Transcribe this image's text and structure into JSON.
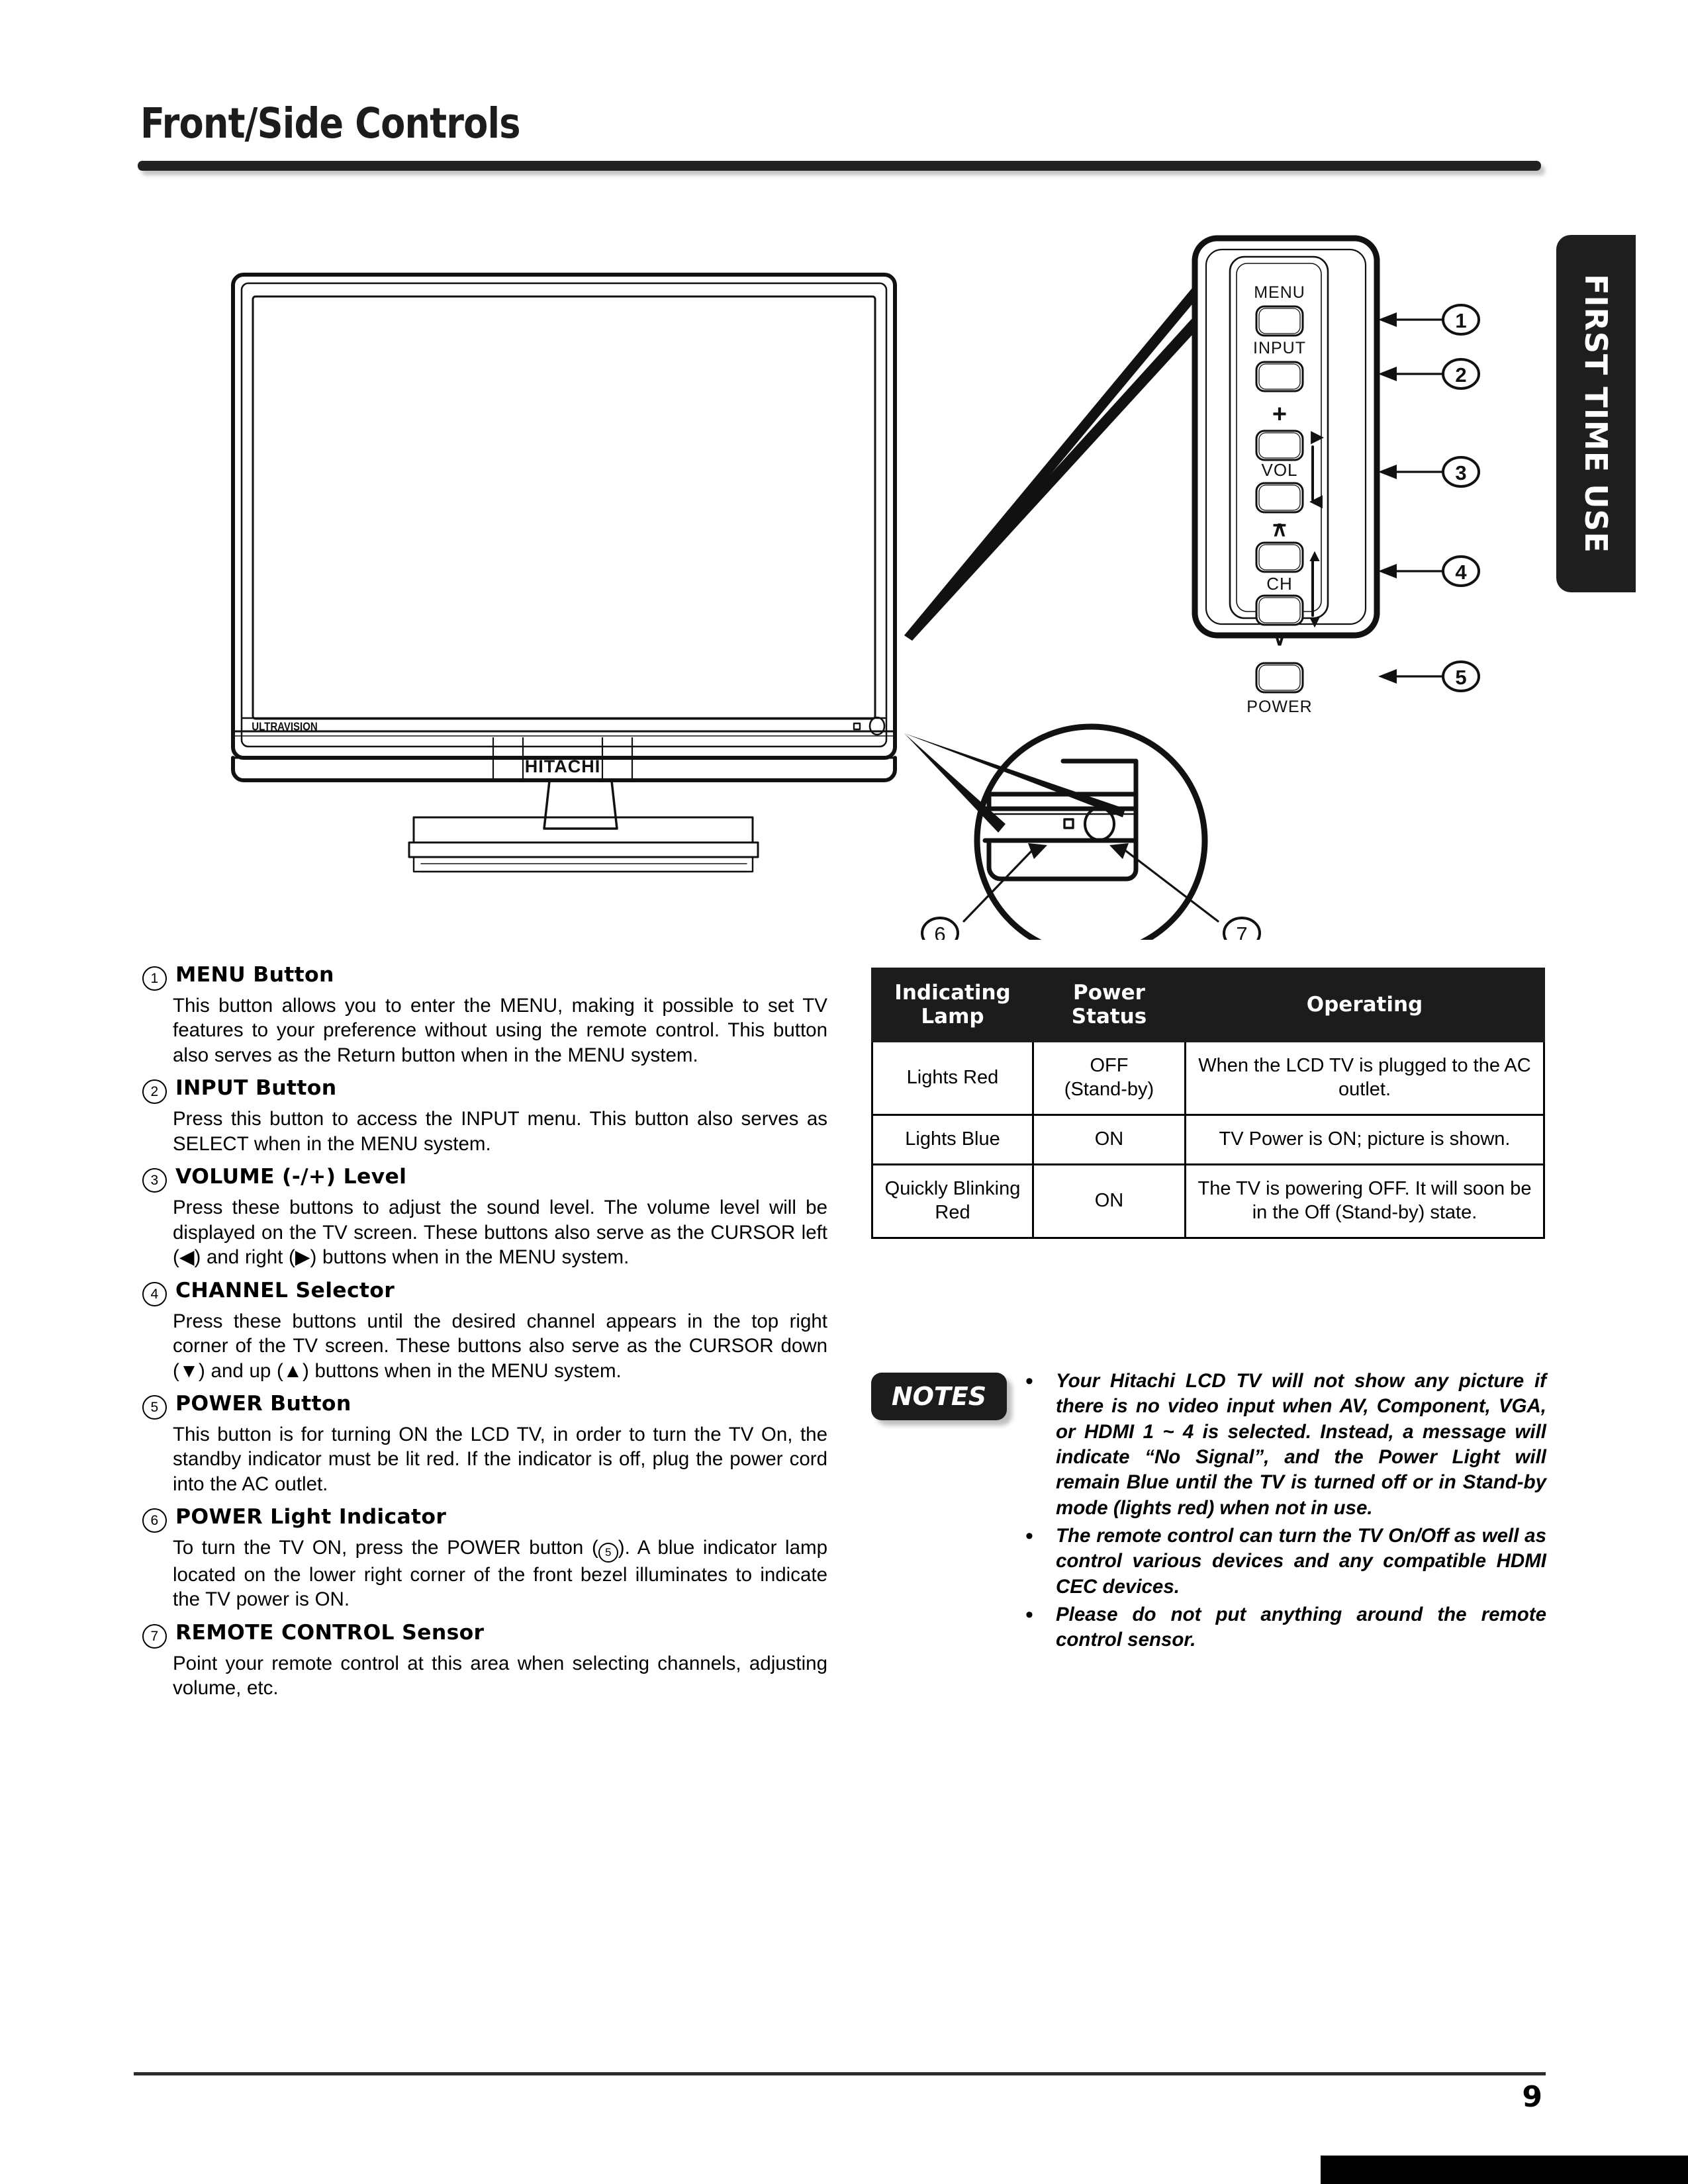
{
  "page": {
    "title": "Front/Side Controls",
    "side_tab_label": "FIRST TIME USE",
    "page_number": "9"
  },
  "illustration": {
    "tv_brand_logo": "HITACHI",
    "tv_sub_logo": "ULTRAVISION",
    "panel_buttons": [
      {
        "label": "MENU",
        "callout": "1"
      },
      {
        "label": "INPUT",
        "callout": "2"
      },
      {
        "label": "VOL",
        "callout": "3",
        "plus": "+",
        "minus": "–",
        "arrow_up": "▶",
        "arrow_down": "◀"
      },
      {
        "label": "CH",
        "callout": "4",
        "up": "∧",
        "down": "∨",
        "arrow_up": "▲",
        "arrow_down": "▼"
      },
      {
        "label": "POWER",
        "callout": "5"
      }
    ],
    "detail_callouts": [
      {
        "callout": "6",
        "target": "power-light-indicator"
      },
      {
        "callout": "7",
        "target": "remote-control-sensor"
      }
    ]
  },
  "controls": [
    {
      "num": "①",
      "heading": "MENU Button",
      "body": "This button allows you to enter the MENU, making it possible to set TV features to your preference without using the remote control. This button also serves as the Return button when in the MENU system."
    },
    {
      "num": "②",
      "heading": "INPUT Button",
      "body": "Press this button to access the INPUT menu. This button also serves as SELECT when in the MENU system."
    },
    {
      "num": "③",
      "heading": "VOLUME (-/+) Level",
      "body_pre": "Press these buttons to adjust the sound level. The volume level will be displayed on the TV screen. These buttons also serve as the CURSOR left (◀) and right (▶) buttons when in the MENU system."
    },
    {
      "num": "④",
      "heading": "CHANNEL Selector",
      "body": "Press these buttons until the desired channel appears in the top right corner of the TV screen. These buttons also serve as the CURSOR down (▼) and up (▲) buttons when in the MENU system."
    },
    {
      "num": "⑤",
      "heading": "POWER Button",
      "body": "This button is for turning ON the LCD TV, in order to turn the TV On, the standby indicator must be lit red. If the indicator is off, plug the power cord into the AC outlet."
    },
    {
      "num": "⑥",
      "heading": "POWER Light Indicator",
      "body_a": "To turn the TV ON, press the POWER button (",
      "body_ref": "5",
      "body_b": "). A blue indicator lamp located on the lower right corner of the front bezel illuminates to indicate the TV power is ON."
    },
    {
      "num": "⑦",
      "heading": "REMOTE CONTROL Sensor",
      "body": "Point your remote control at this area when selecting channels, adjusting volume, etc."
    }
  ],
  "status_table": {
    "headers": [
      "Indicating Lamp",
      "Power Status",
      "Operating"
    ],
    "header_lines": [
      [
        "Indicating",
        "Lamp"
      ],
      [
        "Power",
        "Status"
      ],
      [
        "Operating"
      ]
    ],
    "rows": [
      {
        "lamp": "Lights Red",
        "status": "OFF (Stand-by)",
        "status_l1": "OFF",
        "status_l2": "(Stand-by)",
        "operating": "When the LCD TV is plugged to the AC outlet."
      },
      {
        "lamp": "Lights Blue",
        "status": "ON",
        "status_l1": "ON",
        "status_l2": "",
        "operating": "TV Power is ON; picture is shown."
      },
      {
        "lamp": "Quickly Blinking Red",
        "status": "ON",
        "status_l1": "ON",
        "status_l2": "",
        "operating": "The TV is powering OFF. It will soon be in the Off (Stand-by) state."
      }
    ]
  },
  "notes": {
    "badge": "NOTES",
    "bullet": "•",
    "items": [
      "Your Hitachi LCD TV will not show any picture if there is no video input when AV, Component, VGA, or HDMI 1 ~ 4 is selected. Instead, a message will indicate “No Signal”, and the Power Light will remain Blue until the TV is turned off or in Stand-by mode (lights red) when not in use.",
      "The remote control can turn the TV On/Off as well as control various devices and any compatible HDMI CEC devices.",
      "Please do not put anything around the remote control sensor."
    ]
  },
  "colors": {
    "ink": "#000000",
    "rule": "#212121",
    "tab_bg": "#1e1e1e"
  }
}
